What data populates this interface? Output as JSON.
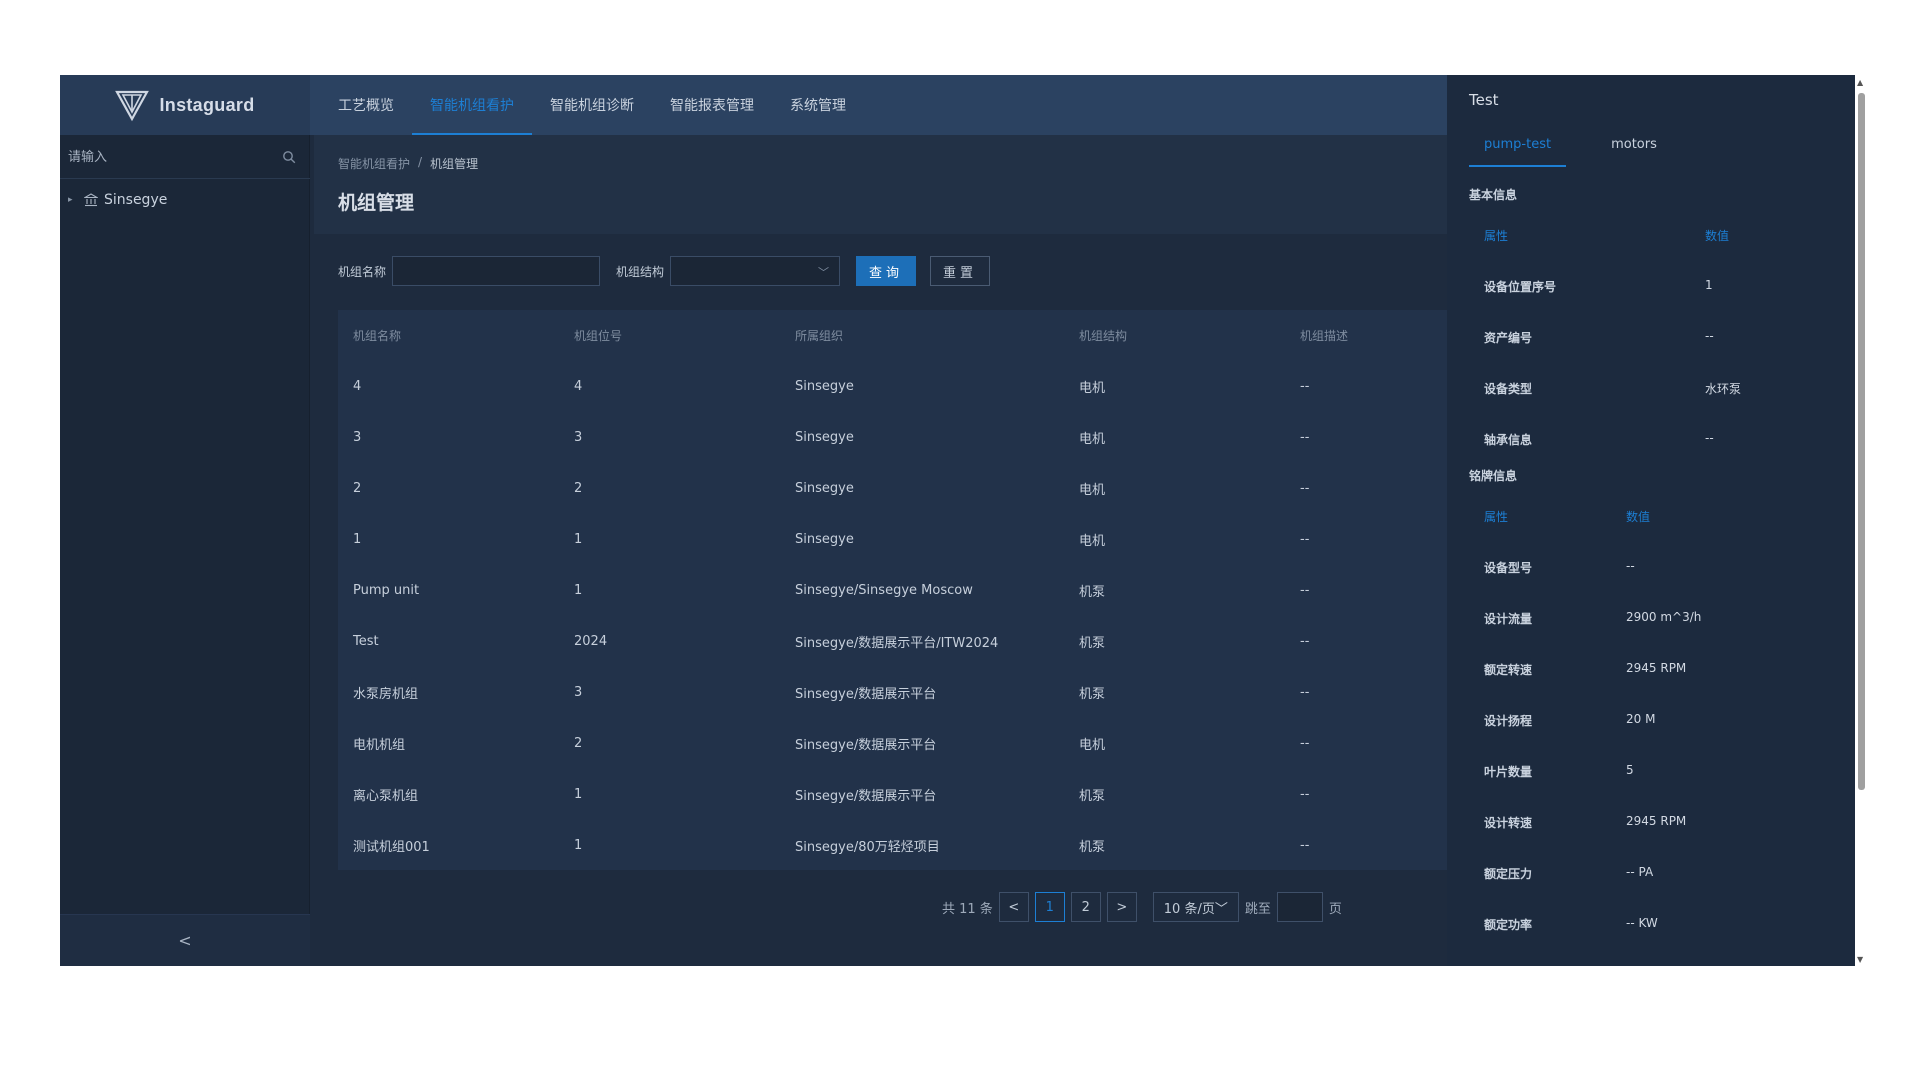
{
  "brand": {
    "name": "Instaguard"
  },
  "nav": [
    {
      "label": "工艺概览"
    },
    {
      "label": "智能机组看护"
    },
    {
      "label": "智能机组诊断"
    },
    {
      "label": "智能报表管理"
    },
    {
      "label": "系统管理"
    }
  ],
  "sidebar": {
    "search_placeholder": "请输入",
    "tree": [
      {
        "label": "Sinsegye"
      }
    ],
    "collapse_glyph": "<"
  },
  "breadcrumb": [
    "智能机组看护",
    "/",
    "机组管理"
  ],
  "page_title": "机组管理",
  "filters": {
    "name_label": "机组名称",
    "name_value": "",
    "structure_label": "机组结构",
    "structure_value": "",
    "query_button": "查询",
    "reset_button": "重置"
  },
  "table": {
    "columns": [
      "机组名称",
      "机组位号",
      "所属组织",
      "机组结构",
      "机组描述"
    ],
    "rows": [
      [
        "4",
        "4",
        "Sinsegye",
        "电机",
        "--"
      ],
      [
        "3",
        "3",
        "Sinsegye",
        "电机",
        "--"
      ],
      [
        "2",
        "2",
        "Sinsegye",
        "电机",
        "--"
      ],
      [
        "1",
        "1",
        "Sinsegye",
        "电机",
        "--"
      ],
      [
        "Pump unit",
        "1",
        "Sinsegye/Sinsegye Moscow",
        "机泵",
        "--"
      ],
      [
        "Test",
        "2024",
        "Sinsegye/数据展示平台/ITW2024",
        "机泵",
        "--"
      ],
      [
        "水泵房机组",
        "3",
        "Sinsegye/数据展示平台",
        "机泵",
        "--"
      ],
      [
        "电机机组",
        "2",
        "Sinsegye/数据展示平台",
        "电机",
        "--"
      ],
      [
        "离心泵机组",
        "1",
        "Sinsegye/数据展示平台",
        "机泵",
        "--"
      ],
      [
        "测试机组001",
        "1",
        "Sinsegye/80万轻烃项目",
        "机泵",
        "--"
      ]
    ]
  },
  "pagination": {
    "total_text": "共 11 条",
    "prev": "<",
    "pages": [
      "1",
      "2"
    ],
    "current": "1",
    "next": ">",
    "page_size": "10 条/页",
    "jump_label": "跳至",
    "jump_value": "",
    "page_suffix": "页"
  },
  "detail_panel": {
    "title": "Test",
    "tabs": [
      "pump-test",
      "motors"
    ],
    "active_tab": "pump-test",
    "basic": {
      "section_title": "基本信息",
      "header": {
        "attr": "属性",
        "value": "数值"
      },
      "rows": [
        {
          "attr": "设备位置序号",
          "value": "1"
        },
        {
          "attr": "资产编号",
          "value": "--"
        },
        {
          "attr": "设备类型",
          "value": "水环泵"
        },
        {
          "attr": "轴承信息",
          "value": "--"
        }
      ]
    },
    "nameplate": {
      "section_title": "铭牌信息",
      "header": {
        "attr": "属性",
        "value": "数值"
      },
      "rows": [
        {
          "attr": "设备型号",
          "value": "--"
        },
        {
          "attr": "设计流量",
          "value": "2900 m^3/h"
        },
        {
          "attr": "额定转速",
          "value": "2945 RPM"
        },
        {
          "attr": "设计扬程",
          "value": "20 M"
        },
        {
          "attr": "叶片数量",
          "value": "5"
        },
        {
          "attr": "设计转速",
          "value": "2945 RPM"
        },
        {
          "attr": "额定压力",
          "value": "-- PA"
        },
        {
          "attr": "额定功率",
          "value": "-- KW"
        }
      ]
    }
  },
  "colors": {
    "accent": "#1d7fd4",
    "header_bg": "#2b4261",
    "page_bg": "#1e2b3e"
  },
  "icons": {
    "logo": "instaguard-v-logo",
    "search": "search-icon",
    "tree": "bank-icon",
    "caret": "caret-right-icon"
  }
}
